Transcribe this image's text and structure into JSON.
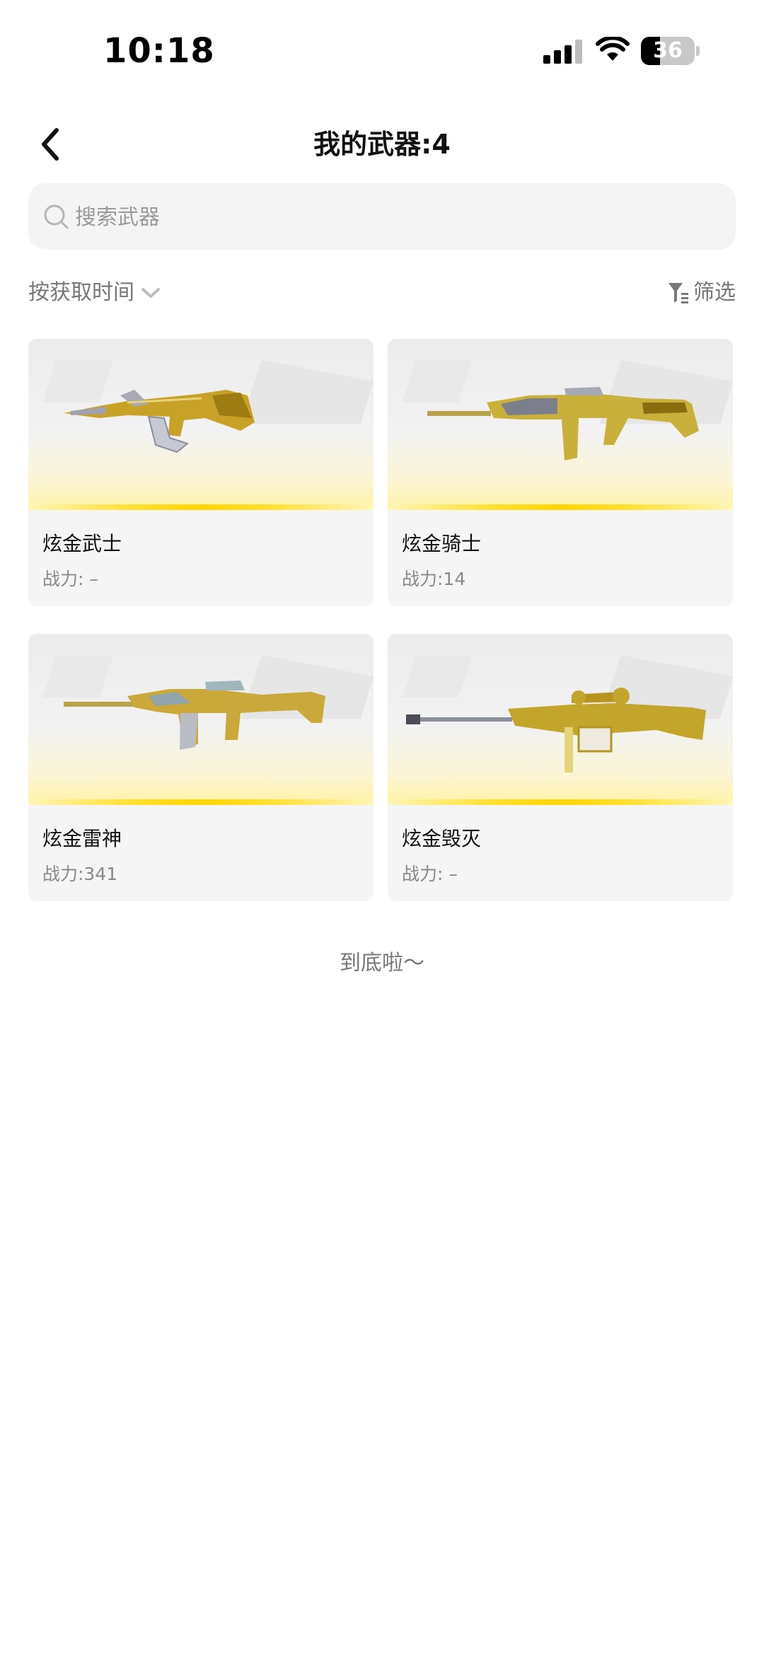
{
  "status_bar": {
    "time": "10:18",
    "battery": "36",
    "battery_level": 0.36
  },
  "header": {
    "title": "我的武器:4"
  },
  "search": {
    "placeholder": "搜索武器"
  },
  "toolbar": {
    "sort_label": "按获取时间",
    "filter_label": "筛选"
  },
  "weapons": [
    {
      "name": "炫金武士",
      "power": "战力: –"
    },
    {
      "name": "炫金骑士",
      "power": "战力:14"
    },
    {
      "name": "炫金雷神",
      "power": "战力:341"
    },
    {
      "name": "炫金毁灭",
      "power": "战力: –"
    }
  ],
  "footer": {
    "end_text": "到底啦～"
  },
  "colors": {
    "accent": "#ffd400",
    "gold": "#c9a21a",
    "text_secondary": "#888888"
  },
  "icons": {
    "back": "chevron-left-icon",
    "search": "search-icon",
    "sort": "chevron-down-icon",
    "filter": "filter-icon"
  }
}
